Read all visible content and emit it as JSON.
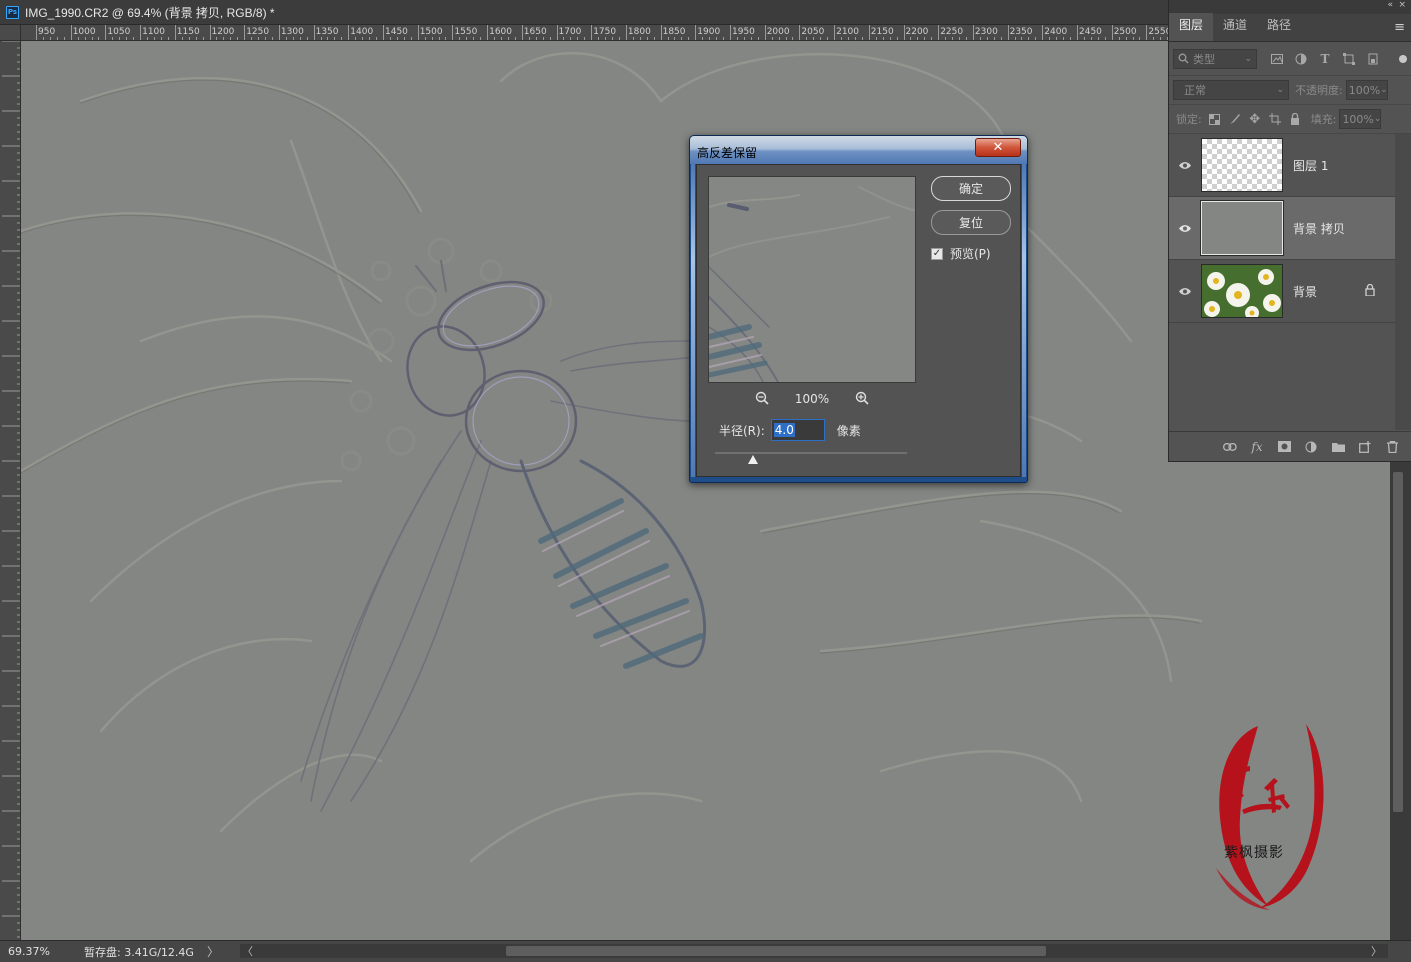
{
  "document": {
    "ps_badge": "Ps",
    "title": "IMG_1990.CR2 @ 69.4% (背景 拷贝, RGB/8) *"
  },
  "ruler": {
    "top_labels": [
      "950",
      "1000",
      "1050",
      "1100",
      "1150",
      "1200",
      "1250",
      "1300",
      "1350",
      "1400",
      "1450",
      "1500",
      "1550",
      "1600",
      "1650",
      "1700",
      "1750",
      "1800",
      "1850",
      "1900",
      "1950",
      "2000",
      "2050",
      "2100",
      "2150",
      "2200",
      "2250",
      "2300",
      "2350",
      "2400",
      "2450",
      "2500",
      "2550"
    ]
  },
  "status": {
    "zoom": "69.37%",
    "scratch": "暂存盘: 3.41G/12.4G",
    "expand_arrow": "〉",
    "scroll_left": "〈",
    "scroll_right": "〉"
  },
  "panel": {
    "tabs": [
      {
        "label": "图层",
        "active": true
      },
      {
        "label": "通道",
        "active": false
      },
      {
        "label": "路径",
        "active": false
      }
    ],
    "menu_glyph": "≡",
    "collapse_glyph": "«",
    "close_glyph": "×",
    "filter_placeholder": "类型",
    "blend_mode": "正常",
    "opacity_label": "不透明度:",
    "opacity_value": "100%",
    "lock_label": "锁定:",
    "fill_label": "填充:",
    "fill_value": "100%",
    "layers": [
      {
        "name": "图层 1",
        "thumbnail": "transparent",
        "visible": true,
        "selected": false,
        "locked": false
      },
      {
        "name": "背景 拷贝",
        "thumbnail": "gray",
        "visible": true,
        "selected": true,
        "locked": false
      },
      {
        "name": "背景",
        "thumbnail": "flowers",
        "visible": true,
        "selected": false,
        "locked": true
      }
    ],
    "footer_icons": [
      "link-icon",
      "fx-icon",
      "mask-icon",
      "adjustment-icon",
      "folder-icon",
      "new-layer-icon",
      "trash-icon"
    ]
  },
  "dialog": {
    "title": "高反差保留",
    "close_glyph": "✕",
    "ok_label": "确定",
    "reset_label": "复位",
    "preview_label": "预览(P)",
    "preview_checked": true,
    "zoom_value": "100%",
    "radius_label": "半径(R):",
    "radius_value": "4.0",
    "radius_unit": "像素",
    "slider_fraction": 0.2
  },
  "watermark": {
    "text": "紫枫摄影",
    "seal_chars": "紫枫"
  },
  "colors": {
    "canvas_gray": "#848684",
    "accent_blue": "#2f6ec6",
    "watermark_red": "#b5121b"
  }
}
